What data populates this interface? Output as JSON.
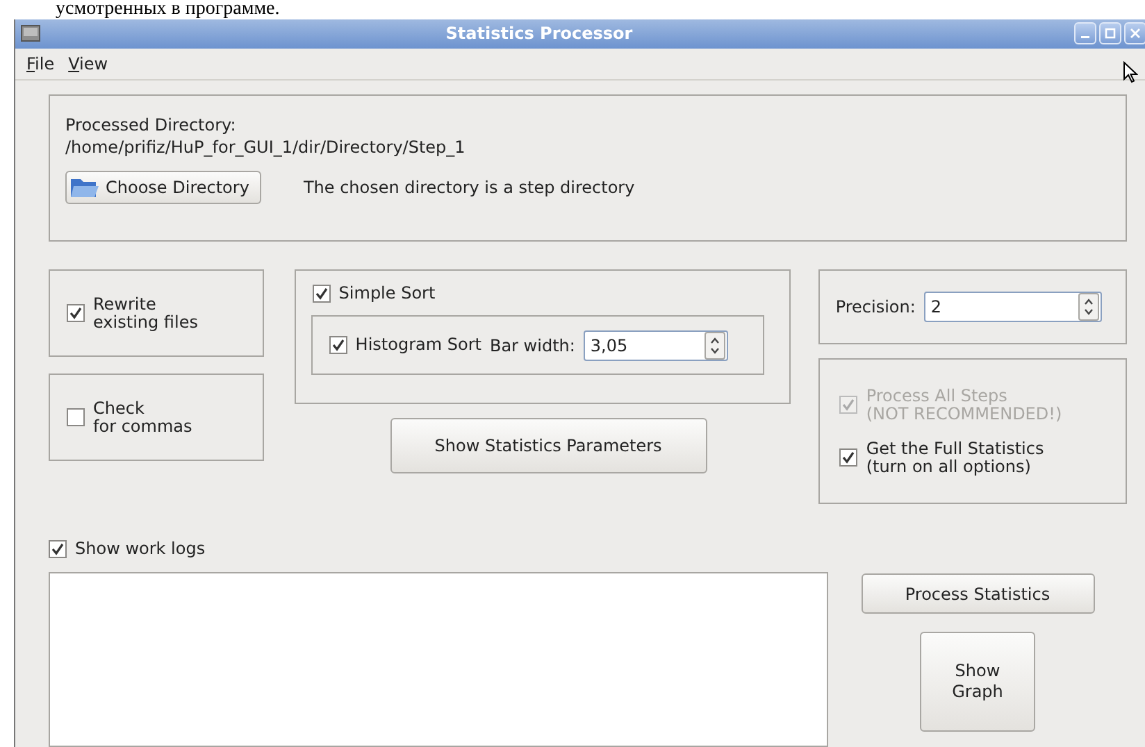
{
  "document_text": "усмотренных в программе.",
  "window": {
    "title": "Statistics Processor"
  },
  "menu": [
    {
      "label": "File"
    },
    {
      "label": "View"
    }
  ],
  "directory": {
    "label": "Processed Directory:",
    "path": "/home/prifiz/HuP_for_GUI_1/dir/Directory/Step_1",
    "button": "Choose Directory",
    "status": "The chosen directory is a step directory"
  },
  "options": [
    {
      "label": "Rewrite\nexisting files",
      "checked": true
    },
    {
      "label": "Check\nfor commas",
      "checked": false
    }
  ],
  "sort": {
    "simple": {
      "label": "Simple Sort",
      "checked": true
    },
    "histogram": {
      "label": "Histogram Sort",
      "checked": true
    },
    "bar_width": {
      "label": "Bar width:",
      "value": "3,05"
    },
    "button": "Show Statistics Parameters"
  },
  "precision": {
    "label": "Precision:",
    "value": "2"
  },
  "steps": [
    {
      "label": "Process All Steps\n(NOT RECOMMENDED!)",
      "checked": true,
      "disabled": true
    },
    {
      "label": "Get the Full Statistics\n(turn on all options)",
      "checked": true,
      "disabled": false
    }
  ],
  "work_logs": {
    "label": "Show work logs",
    "checked": true
  },
  "buttons": {
    "process": "Process Statistics",
    "graph": "Show\nGraph"
  }
}
